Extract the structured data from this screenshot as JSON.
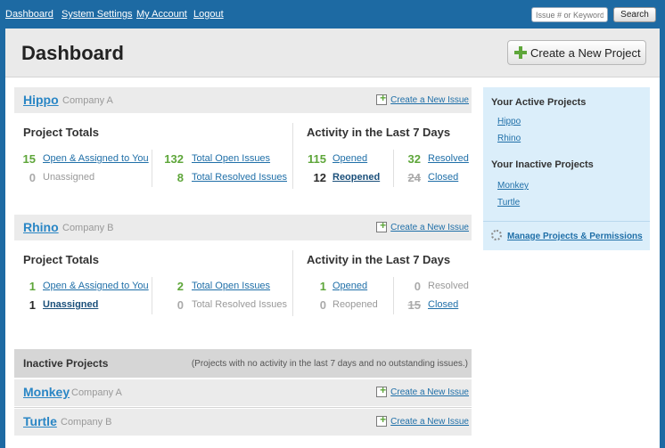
{
  "nav": {
    "links": [
      "Dashboard",
      "System Settings",
      "My Account",
      "Logout"
    ],
    "search_placeholder": "Issue # or Keyword",
    "search_button": "Search"
  },
  "header": {
    "title": "Dashboard",
    "create_project": "Create a New Project"
  },
  "projects": [
    {
      "name": "Hippo",
      "company": "Company A",
      "create_issue": "Create a New Issue",
      "totals_title": "Project Totals",
      "totals": [
        {
          "value": "15",
          "label": "Open & Assigned to You"
        },
        {
          "value": "0",
          "label": "Unassigned"
        },
        {
          "value": "132",
          "label": "Total Open Issues"
        },
        {
          "value": "8",
          "label": "Total Resolved Issues"
        }
      ],
      "activity_title": "Activity in the Last 7 Days",
      "activity": [
        {
          "value": "115",
          "label": "Opened"
        },
        {
          "value": "12",
          "label": "Reopened"
        },
        {
          "value": "32",
          "label": "Resolved"
        },
        {
          "value": "24",
          "label": "Closed"
        }
      ]
    },
    {
      "name": "Rhino",
      "company": "Company B",
      "create_issue": "Create a New Issue",
      "totals_title": "Project Totals",
      "totals": [
        {
          "value": "1",
          "label": "Open & Assigned to You"
        },
        {
          "value": "1",
          "label": "Unassigned"
        },
        {
          "value": "2",
          "label": "Total Open Issues"
        },
        {
          "value": "0",
          "label": "Total Resolved Issues"
        }
      ],
      "activity_title": "Activity in the Last 7 Days",
      "activity": [
        {
          "value": "1",
          "label": "Opened"
        },
        {
          "value": "0",
          "label": "Reopened"
        },
        {
          "value": "0",
          "label": "Resolved"
        },
        {
          "value": "15",
          "label": "Closed"
        }
      ]
    }
  ],
  "inactive": {
    "title": "Inactive Projects",
    "note": "(Projects with no activity in the last 7 days and no outstanding issues.)",
    "projects": [
      {
        "name": "Monkey",
        "company": "Company A",
        "create_issue": "Create a New Issue"
      },
      {
        "name": "Turtle",
        "company": "Company B",
        "create_issue": "Create a New Issue"
      }
    ]
  },
  "sidebar": {
    "active_title": "Your Active Projects",
    "active": [
      "Hippo",
      "Rhino"
    ],
    "inactive_title": "Your Inactive Projects",
    "inactive": [
      "Monkey",
      "Turtle"
    ],
    "manage": "Manage Projects & Permissions"
  },
  "colors": {
    "nav_blue": "#1d6aa3",
    "link_blue": "#1f6fa8",
    "positive_green": "#5ea63a",
    "sidebar_bg": "#dbeefa"
  }
}
